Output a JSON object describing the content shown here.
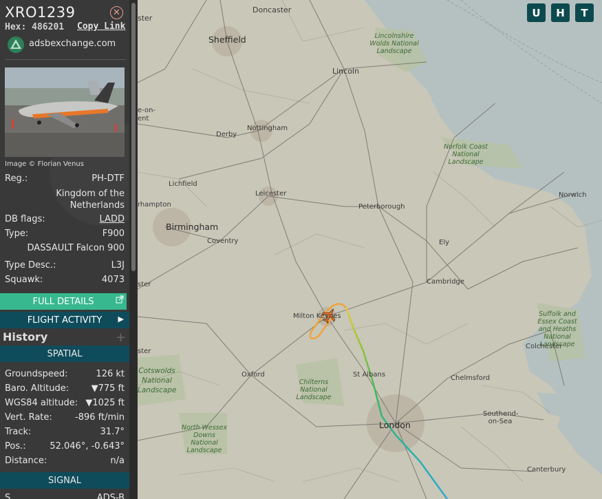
{
  "header": {
    "callsign": "XRO1239",
    "hex_label": "Hex:",
    "hex_value": "486201",
    "copy_link": "Copy Link",
    "site": "adsbexchange.com",
    "photo_credit": "Image © Florian Venus"
  },
  "details": {
    "reg_label": "Reg.:",
    "reg_value": "PH-DTF",
    "country": "Kingdom of the Netherlands",
    "dbflags_label": "DB flags:",
    "dbflags_value": "LADD",
    "type_label": "Type:",
    "type_value": "F900",
    "model": "DASSAULT Falcon 900",
    "typedesc_label": "Type Desc.:",
    "typedesc_value": "L3J",
    "squawk_label": "Squawk:",
    "squawk_value": "4073"
  },
  "buttons": {
    "full_details": "FULL DETAILS",
    "flight_activity": "FLIGHT ACTIVITY"
  },
  "history": {
    "label": "History",
    "plus": "+"
  },
  "spatial": {
    "header": "SPATIAL",
    "groundspeed_label": "Groundspeed:",
    "groundspeed_value": "126 kt",
    "baro_label": "Baro. Altitude:",
    "baro_value": "▼775 ft",
    "wgs_label": "WGS84 altitude:",
    "wgs_value": "▼1025 ft",
    "vrate_label": "Vert. Rate:",
    "vrate_value": "-896 ft/min",
    "track_label": "Track:",
    "track_value": "31.7°",
    "pos_label": "Pos.:",
    "pos_value": "52.046°, -0.643°",
    "dist_label": "Distance:",
    "dist_value": "n/a"
  },
  "signal": {
    "header": "SIGNAL",
    "source_label": "S",
    "source_value": "ADS-B"
  },
  "map_buttons": [
    "U",
    "H",
    "T"
  ],
  "map_places": {
    "doncaster": "Doncaster",
    "sheffield": "Sheffield",
    "lincoln": "Lincoln",
    "nottingham": "Nottingham",
    "derby": "Derby",
    "leicester": "Leicester",
    "lichfield": "Lichfield",
    "birmingham": "Birmingham",
    "coventry": "Coventry",
    "peterborough": "Peterborough",
    "ely": "Ely",
    "norwich": "Norwich",
    "cambridge": "Cambridge",
    "milton_keynes": "Milton Keynes",
    "oxford": "Oxford",
    "st_albans": "St Albans",
    "chelmsford": "Chelmsford",
    "colchester": "Colchester",
    "london": "London",
    "southend": "Southend-on-Sea",
    "canterbury": "Canterbury",
    "ester": "ster",
    "ster2": "ster",
    "ster3": "ster",
    "stoke": "e-on-ent",
    "hampton": "rhampton",
    "lincs_wolds": "Lincolnshire Wolds National Landscape",
    "norfolk_coast": "Norfolk Coast National Landscape",
    "suffolk": "Suffolk and Essex Coast and Heaths National Landscape",
    "chilterns": "Chilterns National Landscape",
    "cotswolds": "Cotswolds National Landscape",
    "north_wessex": "North Wessex Downs National Landscape"
  },
  "colors": {
    "panel": "#393939",
    "accent_green": "#37b88e",
    "section_teal": "#0f4c5b",
    "map_land": "#c9c7b8",
    "sea": "#b7c3c2"
  }
}
